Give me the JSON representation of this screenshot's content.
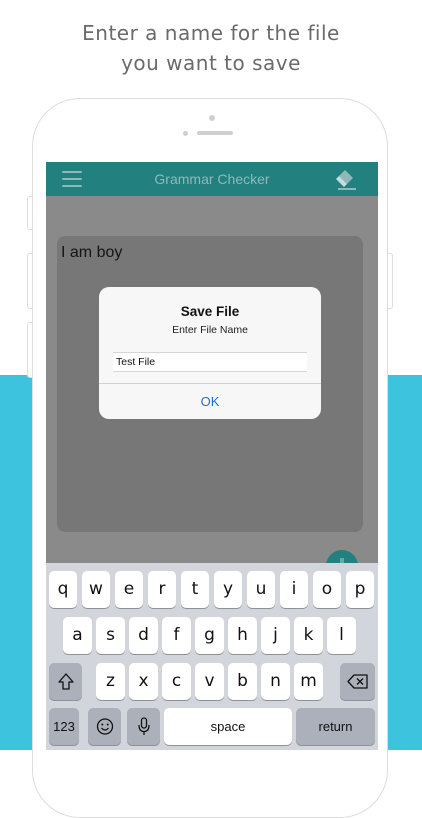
{
  "headline": {
    "line1": "Enter a name for the file",
    "line2": "you want to save"
  },
  "app": {
    "title": "Grammar Checker"
  },
  "editor": {
    "text": "I am boy"
  },
  "dialog": {
    "title": "Save File",
    "message": "Enter File Name",
    "input_value": "Test File",
    "ok_label": "OK"
  },
  "keyboard": {
    "row1": [
      "q",
      "w",
      "e",
      "r",
      "t",
      "y",
      "u",
      "i",
      "o",
      "p"
    ],
    "row2": [
      "a",
      "s",
      "d",
      "f",
      "g",
      "h",
      "j",
      "k",
      "l"
    ],
    "row3": [
      "z",
      "x",
      "c",
      "v",
      "b",
      "n",
      "m"
    ],
    "numbers_label": "123",
    "space_label": "space",
    "return_label": "return"
  },
  "colors": {
    "accent": "#22807f",
    "band": "#3ec3df",
    "link": "#1c6fd6"
  }
}
